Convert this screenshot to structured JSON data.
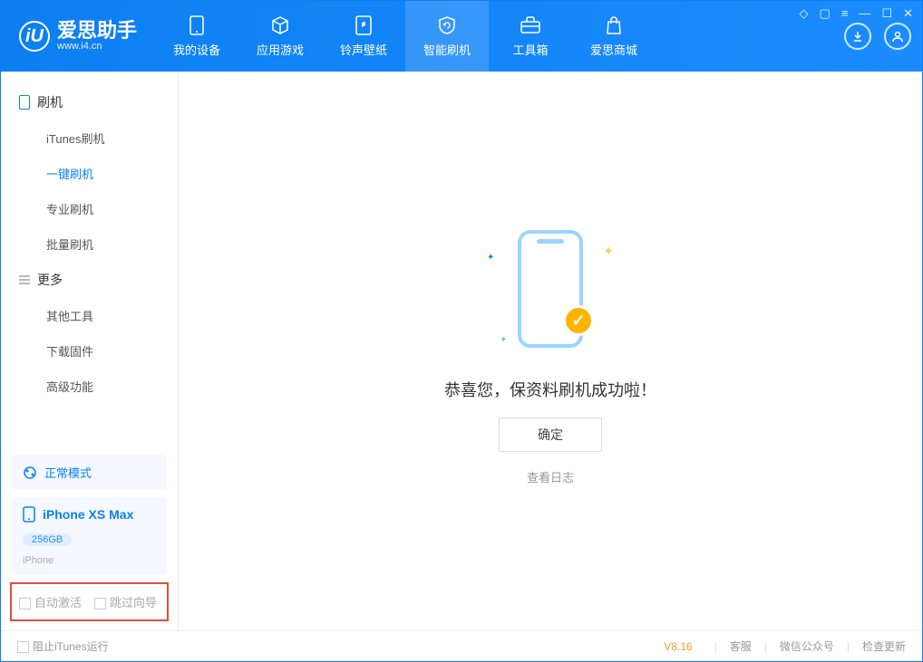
{
  "app": {
    "name": "爱思助手",
    "url": "www.i4.cn",
    "logo_letter": "iU"
  },
  "nav": {
    "my_device": "我的设备",
    "apps_games": "应用游戏",
    "ring_wall": "铃声壁纸",
    "smart_flash": "智能刷机",
    "toolbox": "工具箱",
    "store": "爱思商城"
  },
  "sidebar": {
    "flash_title": "刷机",
    "items": {
      "itunes": "iTunes刷机",
      "oneclick": "一键刷机",
      "pro": "专业刷机",
      "batch": "批量刷机"
    },
    "more_title": "更多",
    "more": {
      "other_tools": "其他工具",
      "download_fw": "下载固件",
      "advanced": "高级功能"
    },
    "mode": "正常模式",
    "device": {
      "name": "iPhone XS Max",
      "storage": "256GB",
      "type": "iPhone"
    },
    "opts": {
      "auto_activate": "自动激活",
      "skip_guide": "跳过向导"
    }
  },
  "main": {
    "success": "恭喜您，保资料刷机成功啦！",
    "ok": "确定",
    "view_log": "查看日志"
  },
  "footer": {
    "block_itunes": "阻止iTunes运行",
    "version": "V8.16",
    "support": "客服",
    "wechat": "微信公众号",
    "update": "检查更新"
  }
}
